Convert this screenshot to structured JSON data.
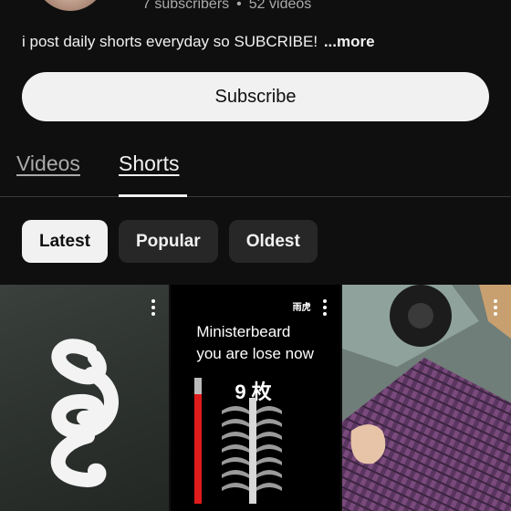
{
  "channel": {
    "subscribers": "7 subscribers",
    "separator": "•",
    "videos": "52 videos",
    "description": "i post daily shorts everyday so SUBCRIBE!",
    "more_label": "...more",
    "subscribe_label": "Subscribe"
  },
  "tabs": [
    {
      "label": "Videos",
      "selected": false
    },
    {
      "label": "Shorts",
      "selected": true
    }
  ],
  "filters": [
    {
      "label": "Latest",
      "selected": true
    },
    {
      "label": "Popular",
      "selected": false
    },
    {
      "label": "Oldest",
      "selected": false
    }
  ],
  "shorts": [
    {
      "overlay_text": []
    },
    {
      "overlay_text": [
        "Ministerbeard",
        "you are lose now",
        "9 枚"
      ],
      "badge": "雨虎"
    },
    {
      "overlay_text": []
    }
  ],
  "colors": {
    "background": "#0f0f0f",
    "primary_text": "#f1f1f1",
    "secondary_text": "#aaaaaa",
    "chip_bg": "#272727",
    "progress_red": "#e01b1b"
  }
}
